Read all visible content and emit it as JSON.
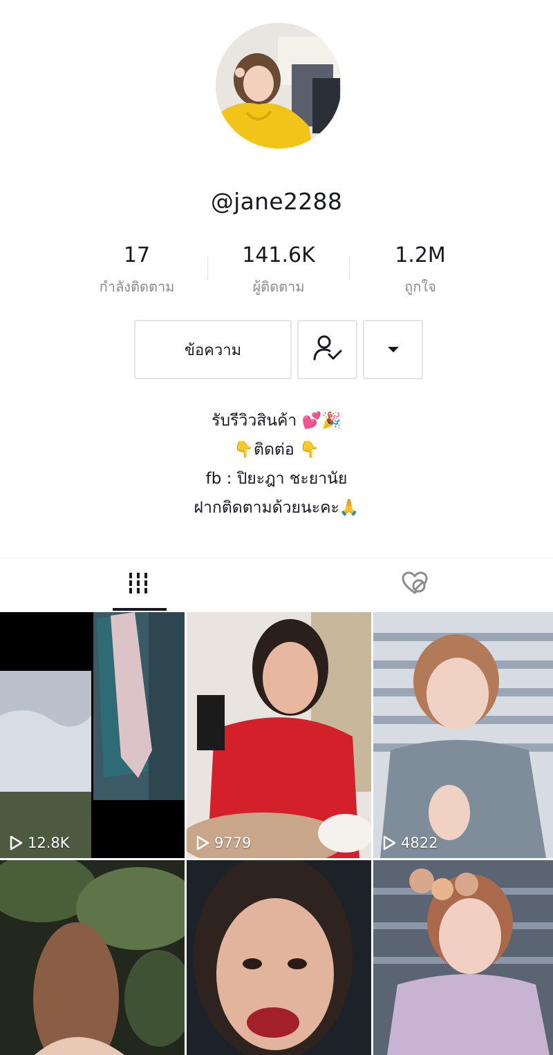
{
  "profile": {
    "username": "@jane2288"
  },
  "stats": [
    {
      "value": "17",
      "label": "กำลังติดตาม"
    },
    {
      "value": "141.6K",
      "label": "ผู้ติดตาม"
    },
    {
      "value": "1.2M",
      "label": "ถูกใจ"
    }
  ],
  "actions": {
    "message_label": "ข้อความ",
    "follow_icon": "user-check-icon",
    "more_icon": "caret-down-icon"
  },
  "bio": {
    "lines": [
      "รับรีวิวสินค้า 💕🎉",
      "👇ติดต่อ 👇",
      "fb : ปิยะฎา ชะยานัย",
      "ฝากติดตามด้วยนะคะ🙏"
    ]
  },
  "tabs": [
    {
      "icon": "grid-icon",
      "active": true
    },
    {
      "icon": "liked-hidden-icon",
      "active": false
    }
  ],
  "videos": [
    {
      "views": "12.8K"
    },
    {
      "views": "9779"
    },
    {
      "views": "4822"
    },
    {
      "views": ""
    },
    {
      "views": ""
    },
    {
      "views": ""
    }
  ],
  "colors": {
    "text": "#161823",
    "secondary": "#8a8b91",
    "border": "#e3e3e4"
  }
}
